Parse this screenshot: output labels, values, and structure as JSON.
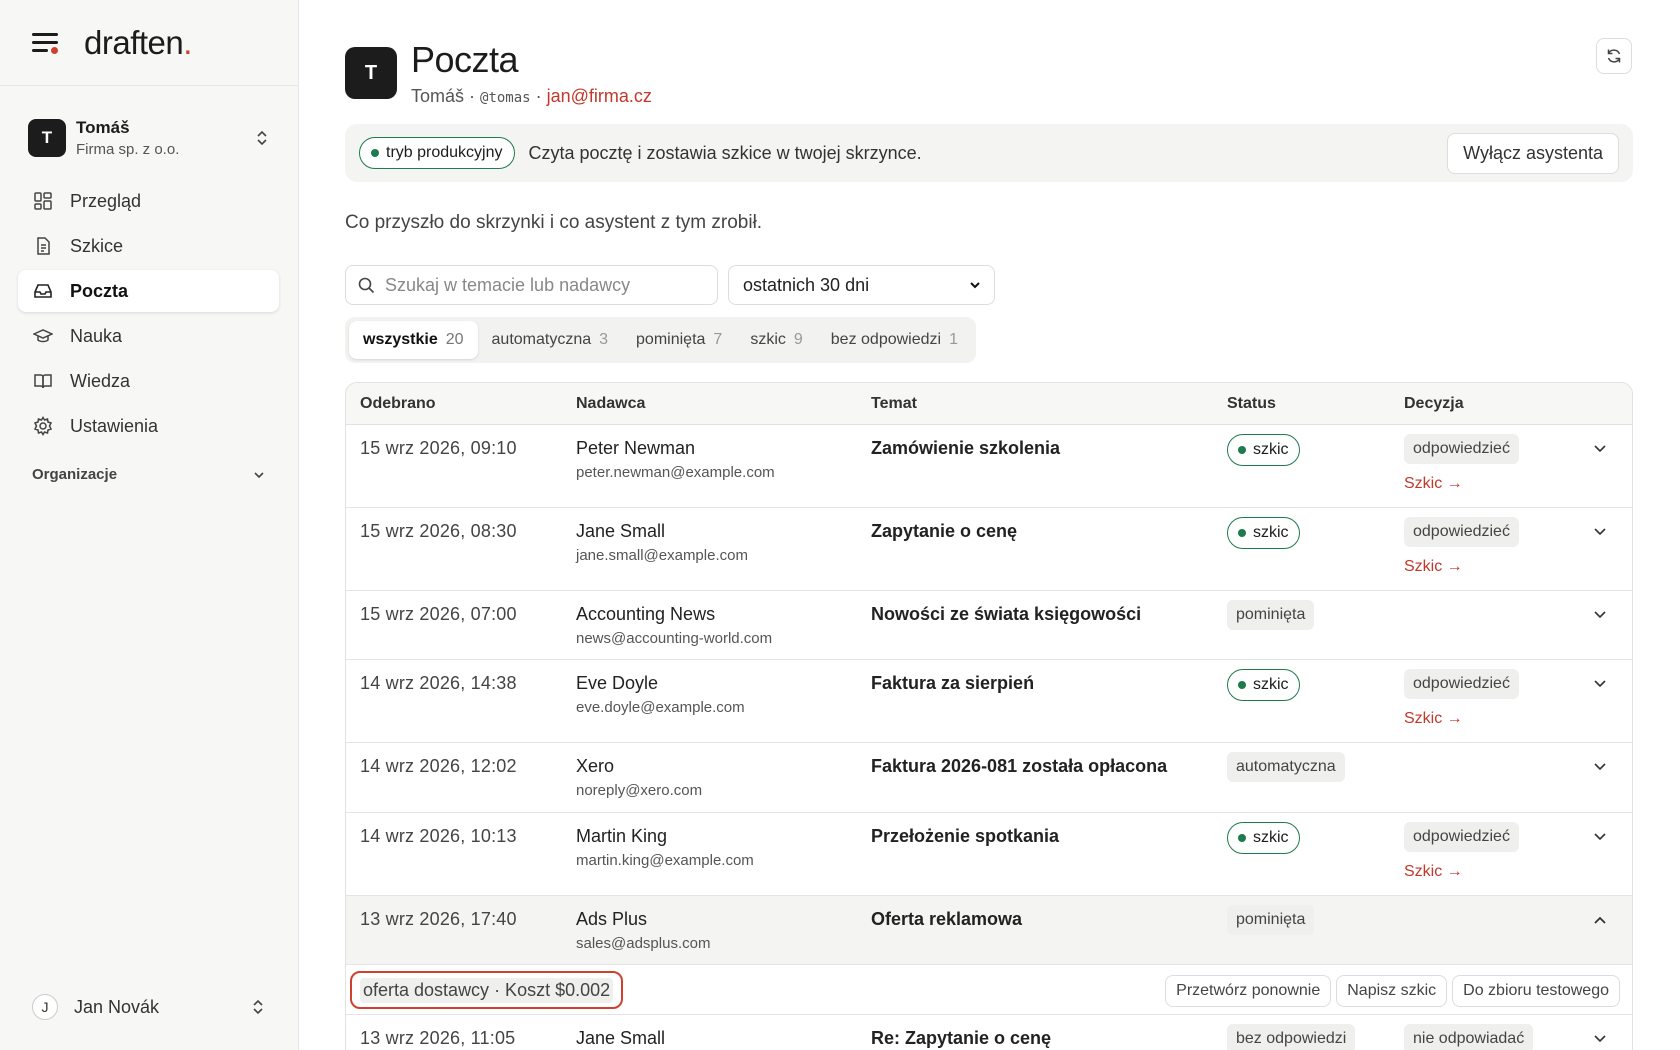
{
  "brand": {
    "name": "draften",
    "dot": "."
  },
  "org": {
    "initial": "T",
    "name": "Tomáš",
    "company": "Firma sp. z o.o."
  },
  "nav": [
    {
      "label": "Przegląd",
      "icon": "grid-icon"
    },
    {
      "label": "Szkice",
      "icon": "document-icon"
    },
    {
      "label": "Poczta",
      "icon": "inbox-icon"
    },
    {
      "label": "Nauka",
      "icon": "graduation-cap-icon"
    },
    {
      "label": "Wiedza",
      "icon": "book-icon"
    },
    {
      "label": "Ustawienia",
      "icon": "gear-icon"
    }
  ],
  "org_section": "Organizacje",
  "user": {
    "initial": "J",
    "name": "Jan Novák"
  },
  "header": {
    "initial": "T",
    "title": "Poczta",
    "name": "Tomáš",
    "sep1": " · ",
    "handle": "@tomas",
    "sep2": " · ",
    "email": "jan@firma.cz"
  },
  "banner": {
    "mode": "tryb produkcyjny",
    "text": "Czyta pocztę i zostawia szkice w twojej skrzynce.",
    "button": "Wyłącz asystenta"
  },
  "subtitle": "Co przyszło do skrzynki i co asystent z tym zrobił.",
  "search": {
    "placeholder": "Szukaj w temacie lub nadawcy"
  },
  "period": {
    "selected": "ostatnich 30 dni"
  },
  "filters": [
    {
      "label": "wszystkie",
      "count": "20"
    },
    {
      "label": "automatyczna",
      "count": "3"
    },
    {
      "label": "pominięta",
      "count": "7"
    },
    {
      "label": "szkic",
      "count": "9"
    },
    {
      "label": "bez odpowiedzi",
      "count": "1"
    }
  ],
  "table": {
    "headers": {
      "received": "Odebrano",
      "sender": "Nadawca",
      "subject": "Temat",
      "status": "Status",
      "decision": "Decyzja"
    },
    "rows": [
      {
        "date": "15 wrz 2026, 09:10",
        "sender": "Peter Newman",
        "email": "peter.newman@example.com",
        "subject": "Zamówienie szkolenia",
        "status": "szkic",
        "decision": "odpowiedzieć",
        "link": "Szkic →"
      },
      {
        "date": "15 wrz 2026, 08:30",
        "sender": "Jane Small",
        "email": "jane.small@example.com",
        "subject": "Zapytanie o cenę",
        "status": "szkic",
        "decision": "odpowiedzieć",
        "link": "Szkic →"
      },
      {
        "date": "15 wrz 2026, 07:00",
        "sender": "Accounting News",
        "email": "news@accounting-world.com",
        "subject": "Nowości ze świata księgowości",
        "status": "pominięta",
        "decision": "",
        "link": ""
      },
      {
        "date": "14 wrz 2026, 14:38",
        "sender": "Eve Doyle",
        "email": "eve.doyle@example.com",
        "subject": "Faktura za sierpień",
        "status": "szkic",
        "decision": "odpowiedzieć",
        "link": "Szkic →"
      },
      {
        "date": "14 wrz 2026, 12:02",
        "sender": "Xero",
        "email": "noreply@xero.com",
        "subject": "Faktura 2026-081 została opłacona",
        "status": "automatyczna",
        "decision": "",
        "link": ""
      },
      {
        "date": "14 wrz 2026, 10:13",
        "sender": "Martin King",
        "email": "martin.king@example.com",
        "subject": "Przełożenie spotkania",
        "status": "szkic",
        "decision": "odpowiedzieć",
        "link": "Szkic →"
      },
      {
        "date": "13 wrz 2026, 17:40",
        "sender": "Ads Plus",
        "email": "sales@adsplus.com",
        "subject": "Oferta reklamowa",
        "status": "pominięta",
        "decision": "",
        "link": ""
      },
      {
        "date": "13 wrz 2026, 11:05",
        "sender": "Jane Small",
        "email": "",
        "subject": "Re: Zapytanie o cenę",
        "status": "bez odpowiedzi",
        "decision": "nie odpowiadać",
        "link": ""
      }
    ],
    "detail": {
      "tag": "oferta dostawcy · Koszt $0.002",
      "actions": [
        "Przetwórz ponownie",
        "Napisz szkic",
        "Do zbioru testowego"
      ]
    }
  },
  "colors": {
    "accent": "#d0402f",
    "green": "#1f7a4d",
    "link": "#c0392b"
  }
}
